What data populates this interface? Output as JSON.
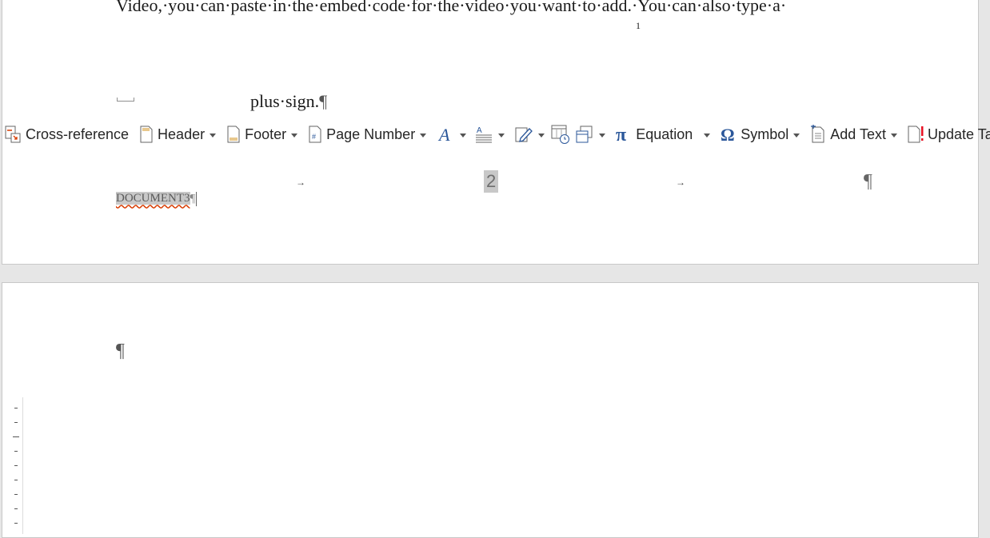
{
  "document": {
    "body_line": "Video,·you·can·paste·in·the·embed·code·for·the·video·you·want·to·add.·You·can·also·type·a·",
    "footnote_ref": "1",
    "body_line2": "plus·sign.",
    "paragraph_mark": "¶"
  },
  "ribbon": {
    "cross_reference": "Cross-reference",
    "header": "Header",
    "footer": "Footer",
    "page_number": "Page Number",
    "equation": "Equation",
    "symbol": "Symbol",
    "add_text": "Add Text",
    "update_table": "Update Table"
  },
  "footer": {
    "tab_arrow": "→",
    "page_number": "2",
    "pilcrow": "¶",
    "doc_field": "DOCUMENT3",
    "doc_pilcrow": "¶"
  },
  "page2": {
    "pilcrow": "¶"
  },
  "colors": {
    "accent_blue": "#2b579a",
    "field_shade": "#c8c8c8",
    "spell_red": "#d83b01",
    "add_text_red": "#e81123"
  },
  "icons": [
    "cross-reference-icon",
    "header-icon",
    "footer-icon",
    "page-number-icon",
    "text-effects-icon",
    "line-spacing-icon",
    "edit-icon",
    "date-time-icon",
    "object-icon",
    "pi-icon",
    "omega-icon",
    "add-text-icon",
    "update-table-icon"
  ]
}
